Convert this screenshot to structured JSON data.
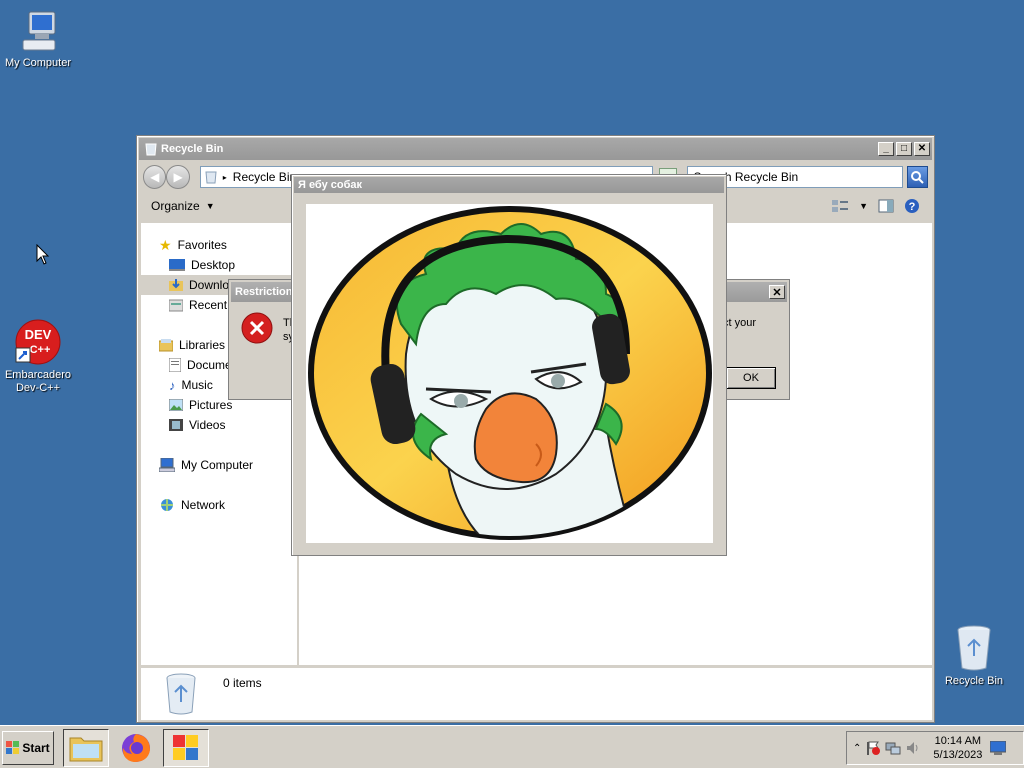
{
  "desktop": {
    "icons": [
      {
        "label": "My Computer"
      },
      {
        "label": "Embarcadero Dev-C++",
        "badge": "DEV C++"
      },
      {
        "label": "Recycle Bin"
      }
    ]
  },
  "explorer": {
    "title": "Recycle Bin",
    "address": "Recycle Bin",
    "search_placeholder": "Search Recycle Bin",
    "organize_label": "Organize",
    "nav": {
      "favorites": "Favorites",
      "desktop": "Desktop",
      "downloads": "Downloads",
      "recent": "Recent Places",
      "libraries": "Libraries",
      "documents": "Documents",
      "music": "Music",
      "pictures": "Pictures",
      "videos": "Videos",
      "computer": "My Computer",
      "network": "Network"
    },
    "status_items": "0 items"
  },
  "restriction_dialog": {
    "title": "Restrictions",
    "text_start": "Th",
    "text_line2": "sy",
    "text_tail": "ct your",
    "ok_label": "OK"
  },
  "image_popup": {
    "title": "Я ебу собак"
  },
  "taskbar": {
    "start_label": "Start",
    "clock_time": "10:14 AM",
    "clock_date": "5/13/2023"
  },
  "colors": {
    "desktop": "#3a6ea5",
    "window_face": "#d4d0c8",
    "titlebar_inactive": "#a0a0a0",
    "image_orange": "#f5a623",
    "image_green": "#3bb54a"
  }
}
